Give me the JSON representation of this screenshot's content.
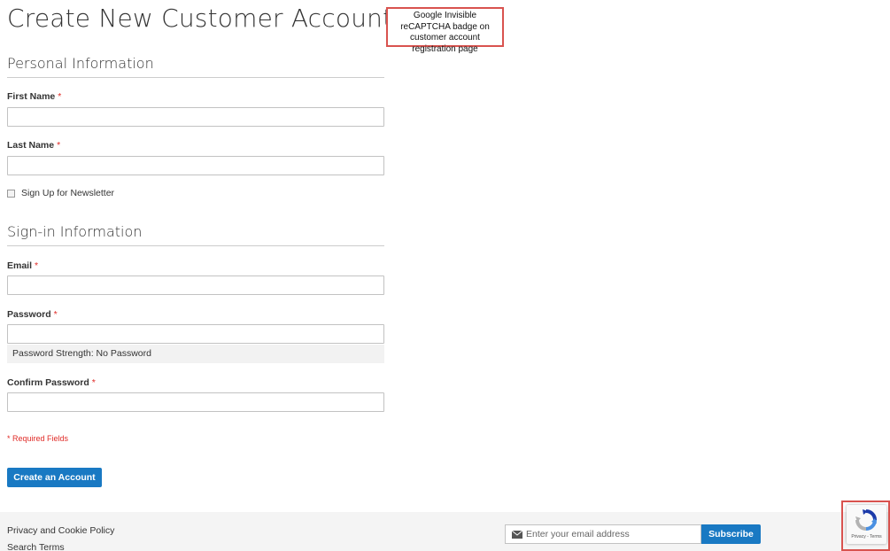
{
  "page": {
    "title": "Create New Customer Account"
  },
  "annotation": {
    "text": "Google Invisible reCAPTCHA badge on customer account registration page"
  },
  "personal_info": {
    "title": "Personal Information",
    "first_name_label": "First Name",
    "first_name_value": "",
    "last_name_label": "Last Name",
    "last_name_value": "",
    "newsletter_label": "Sign Up for Newsletter",
    "newsletter_checked": false
  },
  "signin_info": {
    "title": "Sign-in Information",
    "email_label": "Email",
    "email_value": "",
    "password_label": "Password",
    "password_value": "",
    "password_strength": "Password Strength: No Password",
    "confirm_password_label": "Confirm Password",
    "confirm_password_value": ""
  },
  "form": {
    "required_marker": "*",
    "required_note": "* Required Fields",
    "submit_label": "Create an Account"
  },
  "footer": {
    "links": [
      "Privacy and Cookie Policy",
      "Search Terms"
    ],
    "newsletter_placeholder": "Enter your email address",
    "subscribe_label": "Subscribe"
  },
  "recaptcha": {
    "terms": "Privacy - Terms",
    "icon": "recaptcha-logo-icon"
  },
  "colors": {
    "primary": "#1979c3",
    "required": "#e02b27",
    "annotation_border": "#d9534f",
    "footer_bg": "#f4f4f4"
  }
}
